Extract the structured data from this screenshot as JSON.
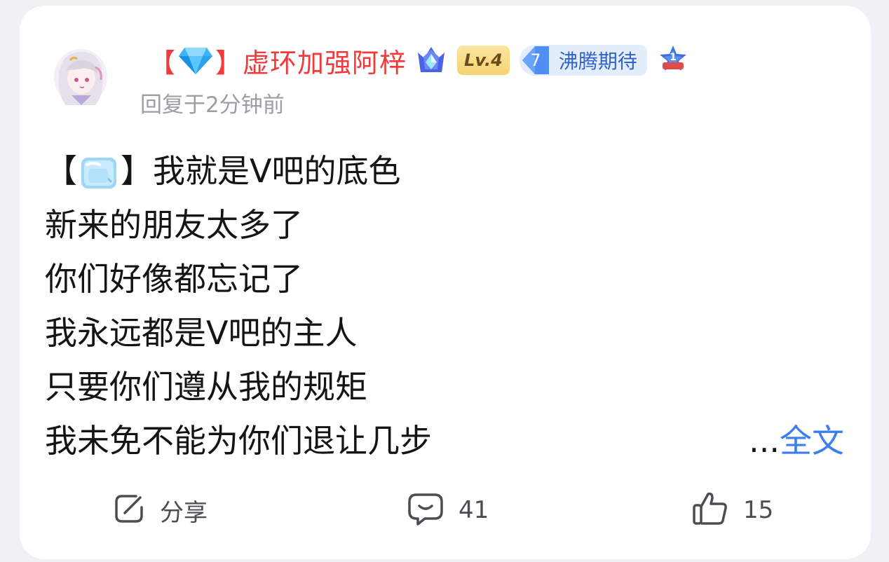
{
  "post": {
    "username": "虚环加强阿梓",
    "bracket_left": "【",
    "bracket_right": "】",
    "level_badge": "Lv.4",
    "fan_level": "7",
    "fan_name": "沸腾期待",
    "rank_badge": "1",
    "timestamp": "回复于2分钟前",
    "content_first_line": {
      "bracket_left": "【",
      "bracket_right": "】",
      "text": "我就是V吧的底色"
    },
    "content_lines": [
      "新来的朋友太多了",
      "你们好像都忘记了",
      "我永远都是V吧的主人",
      "只要你们遵从我的规矩"
    ],
    "content_last_line": "我未免不能为你们退让几步",
    "more_dots": "...",
    "more_label": "全文"
  },
  "actions": {
    "share_label": "分享",
    "comment_count": "41",
    "like_count": "15"
  },
  "colors": {
    "username": "#f23a3a",
    "link": "#3a7ef0",
    "timestamp": "#9b9ea4",
    "text": "#141414",
    "action": "#4a4d52"
  },
  "icons": {
    "avatar": "anime-girl-avatar",
    "diamond": "diamond-icon",
    "crown": "crown-badge-icon",
    "ice": "ice-cube-icon",
    "share": "share-icon",
    "comment": "comment-icon",
    "like": "thumbs-up-icon"
  }
}
